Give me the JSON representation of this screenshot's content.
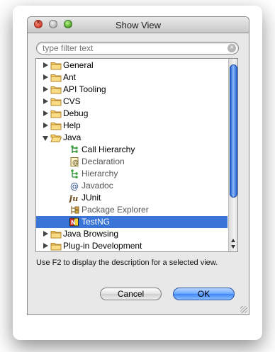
{
  "window": {
    "title": "Show View"
  },
  "search": {
    "placeholder": "type filter text",
    "value": ""
  },
  "tree": {
    "items": [
      {
        "label": "General",
        "icon": "folder-icon",
        "level": 0,
        "expander": "collapsed"
      },
      {
        "label": "Ant",
        "icon": "folder-icon",
        "level": 0,
        "expander": "collapsed"
      },
      {
        "label": "API Tooling",
        "icon": "folder-icon",
        "level": 0,
        "expander": "collapsed"
      },
      {
        "label": "CVS",
        "icon": "folder-icon",
        "level": 0,
        "expander": "collapsed"
      },
      {
        "label": "Debug",
        "icon": "folder-icon",
        "level": 0,
        "expander": "collapsed"
      },
      {
        "label": "Help",
        "icon": "folder-icon",
        "level": 0,
        "expander": "collapsed"
      },
      {
        "label": "Java",
        "icon": "folder-open-icon",
        "level": 0,
        "expander": "expanded"
      },
      {
        "label": "Call Hierarchy",
        "icon": "call-hierarchy-icon",
        "level": 1
      },
      {
        "label": "Declaration",
        "icon": "declaration-icon",
        "level": 1
      },
      {
        "label": "Hierarchy",
        "icon": "hierarchy-icon",
        "level": 1
      },
      {
        "label": "Javadoc",
        "icon": "javadoc-icon",
        "level": 1
      },
      {
        "label": "JUnit",
        "icon": "junit-icon",
        "level": 1
      },
      {
        "label": "Package Explorer",
        "icon": "package-explorer-icon",
        "level": 1
      },
      {
        "label": "TestNG",
        "icon": "testng-icon",
        "level": 1,
        "selected": true
      },
      {
        "label": "Java Browsing",
        "icon": "folder-icon",
        "level": 0,
        "expander": "collapsed"
      },
      {
        "label": "Plug-in Development",
        "icon": "folder-icon",
        "level": 0,
        "expander": "collapsed"
      }
    ]
  },
  "description": "Use F2 to display the description for a selected view.",
  "buttons": {
    "cancel": "Cancel",
    "ok": "OK"
  },
  "colors": {
    "selection": "#3875d7",
    "folder": "#f0c75a",
    "default_button": "#4a8df0"
  }
}
